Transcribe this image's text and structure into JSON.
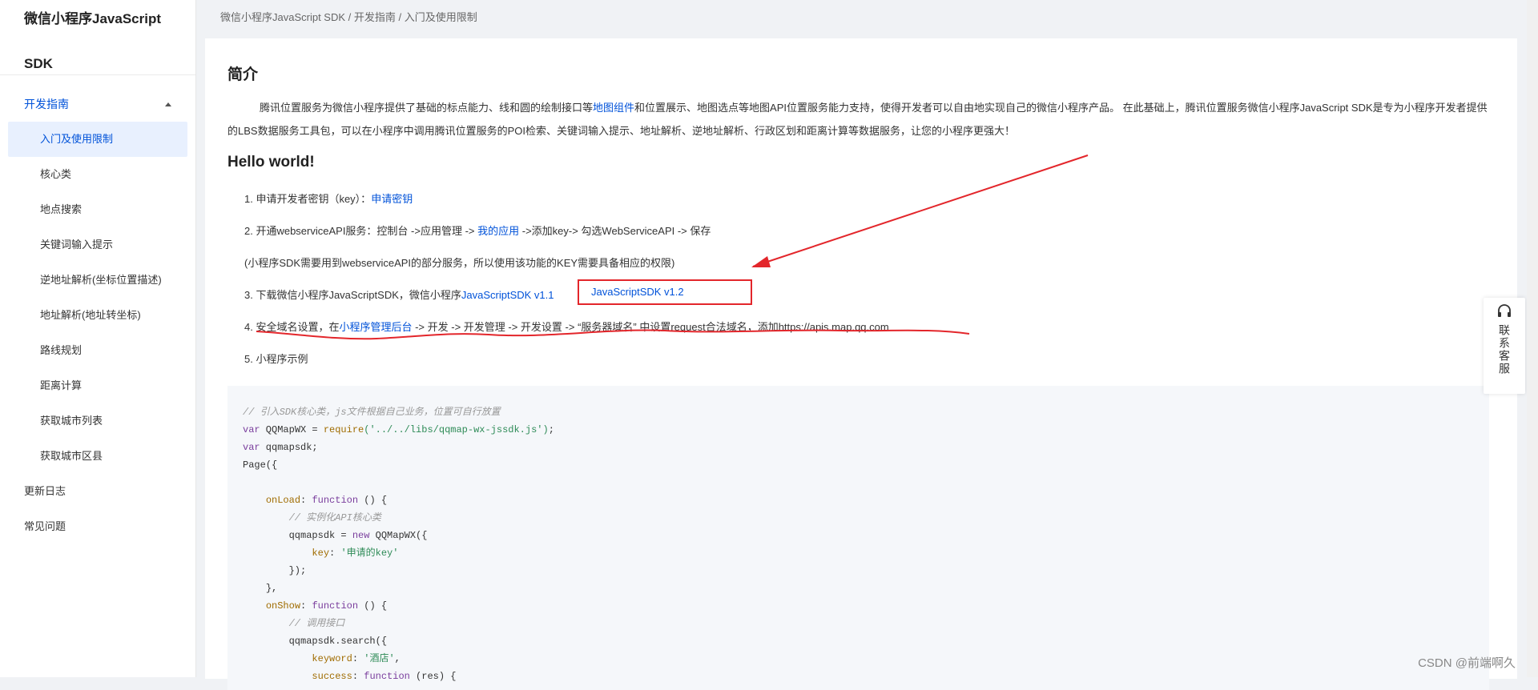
{
  "sidebar": {
    "brand_line1": "微信小程序JavaScript",
    "brand_line2": "SDK",
    "group_label": "开发指南",
    "items": [
      "入门及使用限制",
      "核心类",
      "地点搜索",
      "关键词输入提示",
      "逆地址解析(坐标位置描述)",
      "地址解析(地址转坐标)",
      "路线规划",
      "距离计算",
      "获取城市列表",
      "获取城市区县"
    ],
    "top_items": [
      "更新日志",
      "常见问题"
    ]
  },
  "breadcrumb": "微信小程序JavaScript SDK / 开发指南 / 入门及使用限制",
  "content": {
    "intro_title": "简介",
    "intro_p1": "腾讯位置服务为微信小程序提供了基础的标点能力、线和圆的绘制接口等",
    "intro_link": "地图组件",
    "intro_p2": "和位置展示、地图选点等地图API位置服务能力支持，使得开发者可以自由地实现自己的微信小程序产品。 在此基础上，腾讯位置服务微信小程序JavaScript SDK是专为小程序开发者提供的LBS数据服务工具包，可以在小程序中调用腾讯位置服务的POI检索、关键词输入提示、地址解析、逆地址解析、行政区划和距离计算等数据服务，让您的小程序更强大！",
    "hello_title": "Hello world!",
    "step1_text": "1. 申请开发者密钥（key）：",
    "step1_link": "申请密钥",
    "step2_a": "2. 开通webserviceAPI服务：控制台 ->应用管理 -> ",
    "step2_link": "我的应用",
    "step2_b": " ->添加key-> 勾选WebServiceAPI -> 保存",
    "step2_note": "(小程序SDK需要用到webserviceAPI的部分服务，所以使用该功能的KEY需要具备相应的权限)",
    "step3_text": "3. 下载微信小程序JavaScriptSDK，微信小程序",
    "step3_link1": "JavaScriptSDK v1.1",
    "step3_link2": "JavaScriptSDK v1.2",
    "step4_a": "4. 安全域名设置，在",
    "step4_link": "小程序管理后台",
    "step4_b": " -> 开发 -> 开发管理 -> 开发设置 -> “服务器域名” 中设置request合法域名，添加https://apis.map.qq.com",
    "step5_text": "5. 小程序示例"
  },
  "code_lines": {
    "c1": "// 引入SDK核心类，js文件根据自己业务，位置可自行放置",
    "l2_kw": "var",
    "l2_rest": " QQMapWX = ",
    "l2_fn": "require",
    "l2_str": "('../../libs/qqmap-wx-jssdk.js')",
    "l2_end": ";",
    "l3_kw": "var",
    "l3_rest": " qqmapsdk;",
    "l4": "Page({",
    "l6_fn": "onLoad",
    "l6_kw": "function",
    "l6_end": " () {",
    "c7": "// 实例化API核心类",
    "l8_a": "qqmapsdk = ",
    "l8_kw": "new",
    "l8_b": " QQMapWX({",
    "l9_fn": "key",
    "l9_str": "'申请的key'",
    "l10": "});",
    "l11": "},",
    "l12_fn": "onShow",
    "l12_kw": "function",
    "l12_end": " () {",
    "c13": "// 调用接口",
    "l14": "qqmapsdk.search({",
    "l15_fn": "keyword",
    "l15_str": "'酒店'",
    "l16_fn": "success",
    "l16_kw": "function",
    "l16_end": " (res) {"
  },
  "service_widget": {
    "label": "联系客服",
    "icon": "headset-icon"
  },
  "watermark": "CSDN @前端啊久",
  "colors": {
    "link": "#0052d9",
    "annotation": "#e3262b"
  }
}
